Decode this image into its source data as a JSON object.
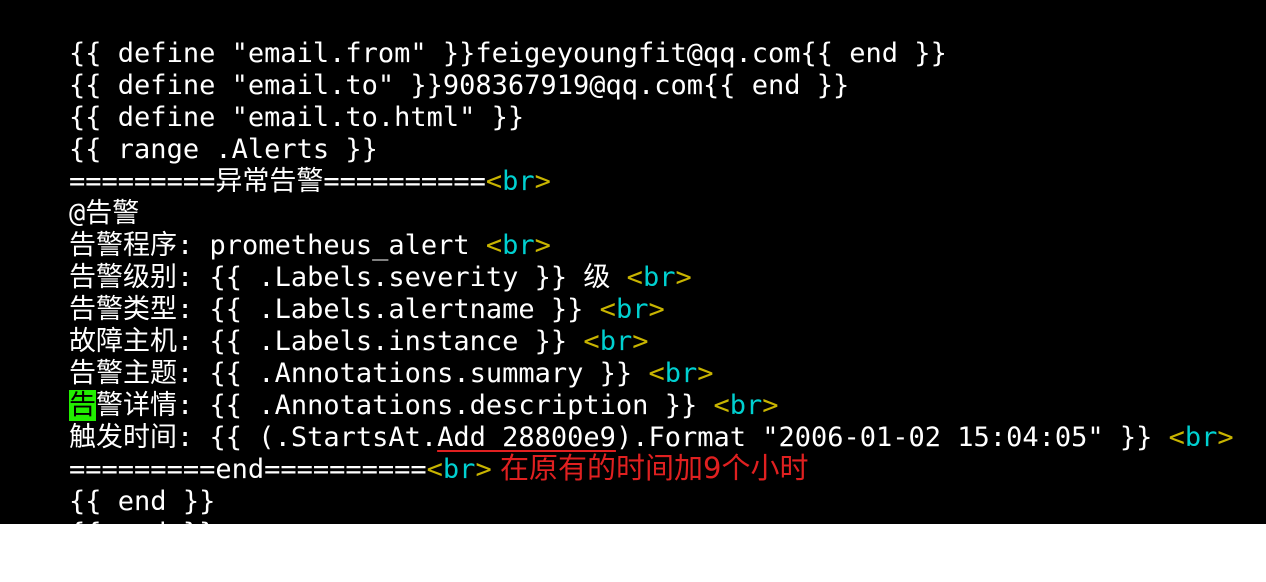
{
  "lines": [
    {
      "text": "{{ define \"email.from\" }}feigeyoungfit@qq.com{{ end }}"
    },
    {
      "text": "{{ define \"email.to\" }}908367919@qq.com{{ end }}"
    },
    {
      "text": "{{ define \"email.to.html\" }}"
    },
    {
      "text": "{{ range .Alerts }}"
    },
    {
      "text_a": "=========异常告警==========",
      "tag": "<br>"
    },
    {
      "text": "@告警"
    },
    {
      "text_a": "告警程序: prometheus_alert ",
      "tag": "<br>"
    },
    {
      "text_a": "告警级别: {{ .Labels.severity }} 级 ",
      "tag": "<br>"
    },
    {
      "text_a": "告警类型: {{ .Labels.alertname }} ",
      "tag": "<br>"
    },
    {
      "text_a": "故障主机: {{ .Labels.instance }} ",
      "tag": "<br>"
    },
    {
      "text_a": "告警主题: {{ .Annotations.summary }} ",
      "tag": "<br>"
    },
    {
      "hl": "告",
      "text_a": "警详情: {{ .Annotations.description }} ",
      "tag": "<br>"
    },
    {
      "text_a": "触发时间: {{ (.StartsAt.",
      "underlined": "Add 28800e9",
      "text_b": ").Format \"2006-01-02 15:04:05\" }} ",
      "tag": "<br>"
    },
    {
      "text_a": "=========end==========",
      "tag": "<br>"
    },
    {
      "text": "{{ end }}"
    },
    {
      "text": "{{ end }}"
    }
  ],
  "annotation": "在原有的时间加9个小时",
  "colors": {
    "background": "#000000",
    "text": "#ffffff",
    "tag_bracket": "#c8b400",
    "tag_name": "#00d0d0",
    "highlight": "#22ee00",
    "annotation": "#e02020"
  }
}
